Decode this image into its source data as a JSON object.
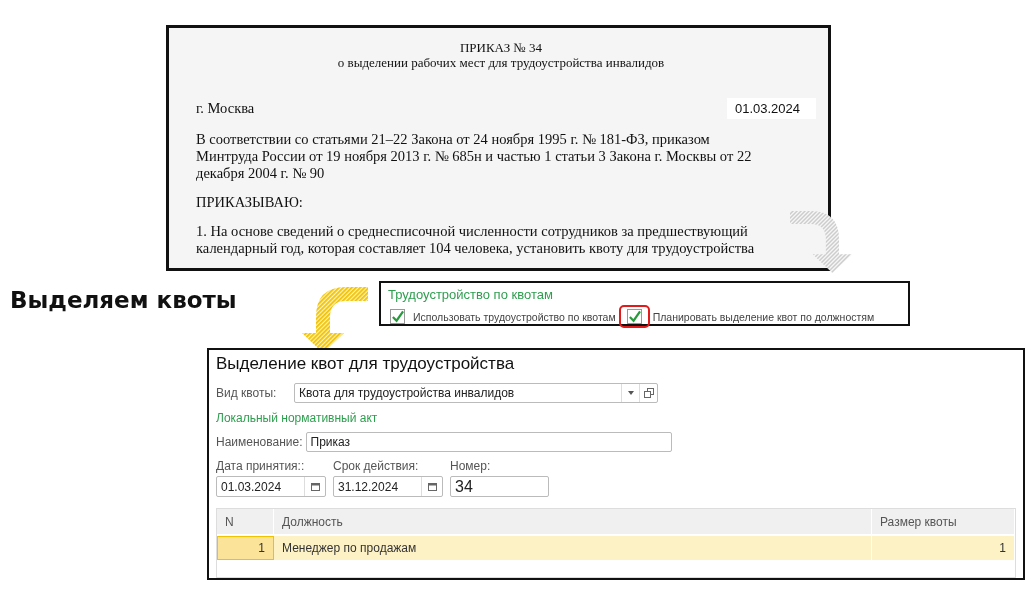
{
  "document": {
    "title": "ПРИКАЗ № 34",
    "subtitle": "о выделении рабочих мест для трудоустройства инвалидов",
    "city": "г. Москва",
    "date": "01.03.2024",
    "paragraphs": [
      "В соответствии со статьями 21–22 Закона от 24 ноября 1995 г. № 181-ФЗ, приказом Минтруда России от 19 ноября 2013 г. № 685н и частью 1 статьи 3 Закона г. Москвы от 22 декабря 2004 г. № 90",
      "ПРИКАЗЫВАЮ:",
      "1. На основе сведений о среднесписочной численности сотрудников за предшествующий календарный год, которая составляет 104 человека, установить квоту для трудоустройства"
    ]
  },
  "heading": "Выделяем квоты",
  "settings": {
    "title": "Трудоустройство по квотам",
    "options": [
      {
        "label": "Использовать трудоустройство по квотам",
        "checked": true,
        "highlighted": false
      },
      {
        "label": "Планировать выделение квот по должностям",
        "checked": true,
        "highlighted": true
      }
    ]
  },
  "form": {
    "title": "Выделение квот для трудоустройства",
    "quota_type": {
      "label": "Вид квоты:",
      "value": "Квота для трудоустройства инвалидов"
    },
    "section": "Локальный нормативный акт",
    "name": {
      "label": "Наименование:",
      "value": "Приказ"
    },
    "adoption_date": {
      "label": "Дата принятия::",
      "value": "01.03.2024"
    },
    "validity": {
      "label": "Срок действия:",
      "value": "31.12.2024"
    },
    "number": {
      "label": "Номер:",
      "value": "34"
    },
    "table": {
      "columns": [
        "N",
        "Должность",
        "Размер квоты"
      ],
      "rows": [
        {
          "cells": [
            "1",
            "Менеджер по продажам",
            "1"
          ],
          "selected": true
        }
      ]
    }
  }
}
